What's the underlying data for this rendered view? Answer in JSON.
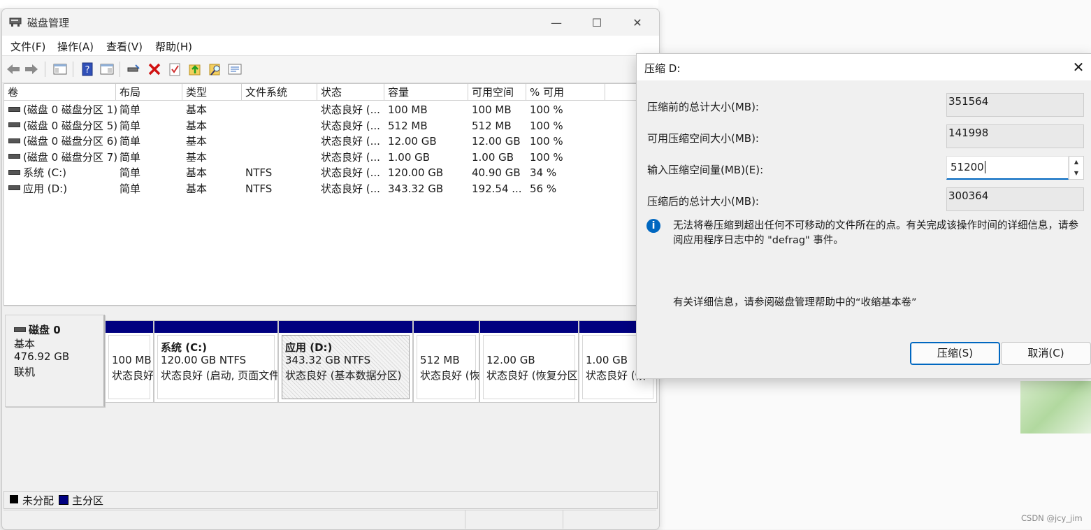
{
  "window": {
    "title": "磁盘管理",
    "menu": [
      "文件(F)",
      "操作(A)",
      "查看(V)",
      "帮助(H)"
    ],
    "controls": {
      "minimize": "—",
      "maximize": "☐",
      "close": "✕"
    }
  },
  "toolbar_icons": [
    "back-icon",
    "forward-icon",
    "show-hide-console-tree-icon",
    "help-icon",
    "properties-view-icon",
    "connect-drive-icon",
    "delete-icon",
    "check-icon",
    "import-icon",
    "search-icon",
    "properties-icon"
  ],
  "volume_list": {
    "columns": [
      "卷",
      "布局",
      "类型",
      "文件系统",
      "状态",
      "容量",
      "可用空间",
      "% 可用"
    ],
    "rows": [
      [
        "(磁盘 0 磁盘分区 1)",
        "简单",
        "基本",
        "",
        "状态良好 (...",
        "100 MB",
        "100 MB",
        "100 %"
      ],
      [
        "(磁盘 0 磁盘分区 5)",
        "简单",
        "基本",
        "",
        "状态良好 (...",
        "512 MB",
        "512 MB",
        "100 %"
      ],
      [
        "(磁盘 0 磁盘分区 6)",
        "简单",
        "基本",
        "",
        "状态良好 (...",
        "12.00 GB",
        "12.00 GB",
        "100 %"
      ],
      [
        "(磁盘 0 磁盘分区 7)",
        "简单",
        "基本",
        "",
        "状态良好 (...",
        "1.00 GB",
        "1.00 GB",
        "100 %"
      ],
      [
        "系统 (C:)",
        "简单",
        "基本",
        "NTFS",
        "状态良好 (...",
        "120.00 GB",
        "40.90 GB",
        "34 %"
      ],
      [
        "应用 (D:)",
        "简单",
        "基本",
        "NTFS",
        "状态良好 (...",
        "343.32 GB",
        "192.54 ...",
        "56 %"
      ]
    ]
  },
  "disk": {
    "name": "磁盘 0",
    "type": "基本",
    "size": "476.92 GB",
    "status": "联机",
    "partitions": [
      {
        "title": "",
        "line1": "100 MB",
        "line2": "状态良好"
      },
      {
        "title": "系统 (C:)",
        "line1": "120.00 GB NTFS",
        "line2": "状态良好 (启动, 页面文件"
      },
      {
        "title": "应用 (D:)",
        "line1": "343.32 GB NTFS",
        "line2": "状态良好 (基本数据分区)"
      },
      {
        "title": "",
        "line1": "512 MB",
        "line2": "状态良好 (恢"
      },
      {
        "title": "",
        "line1": "12.00 GB",
        "line2": "状态良好 (恢复分区"
      },
      {
        "title": "",
        "line1": "1.00 GB",
        "line2": "状态良好 (恢"
      }
    ]
  },
  "legend": [
    {
      "label": "未分配",
      "color": "#000000"
    },
    {
      "label": "主分区",
      "color": "#000080"
    }
  ],
  "dialog": {
    "title": "压缩 D:",
    "fields": {
      "total_before_label": "压缩前的总计大小(MB):",
      "total_before": "351564",
      "available_label": "可用压缩空间大小(MB):",
      "available": "141998",
      "input_label": "输入压缩空间量(MB)(E):",
      "input_value": "51200",
      "total_after_label": "压缩后的总计大小(MB):",
      "total_after": "300364"
    },
    "info": "无法将卷压缩到超出任何不可移动的文件所在的点。有关完成该操作时间的详细信息，请参阅应用程序日志中的 \"defrag\" 事件。",
    "help": "有关详细信息，请参阅磁盘管理帮助中的“收缩基本卷”",
    "buttons": {
      "ok": "压缩(S)",
      "cancel": "取消(C)"
    }
  },
  "watermark": "CSDN @jcy_jim"
}
